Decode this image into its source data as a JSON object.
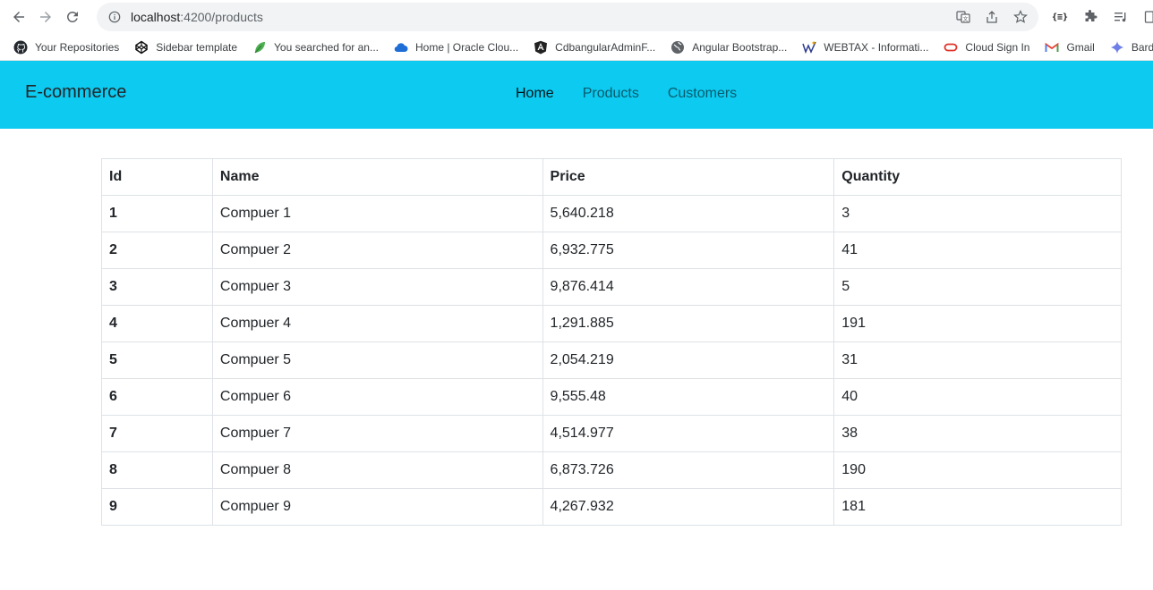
{
  "browser": {
    "url_host": "localhost",
    "url_rest": ":4200/products",
    "extension_label": "{≡}"
  },
  "bookmarks": [
    {
      "label": "Your Repositories",
      "icon": "github-icon"
    },
    {
      "label": "Sidebar template",
      "icon": "codepen-icon"
    },
    {
      "label": "You searched for an...",
      "icon": "leaf-icon"
    },
    {
      "label": "Home | Oracle Clou...",
      "icon": "cloud-icon"
    },
    {
      "label": "CdbangularAdminF...",
      "icon": "angular-icon"
    },
    {
      "label": "Angular Bootstrap...",
      "icon": "globe-icon"
    },
    {
      "label": "WEBTAX - Informati...",
      "icon": "webtax-icon"
    },
    {
      "label": "Cloud Sign In",
      "icon": "oracle-icon"
    },
    {
      "label": "Gmail",
      "icon": "gmail-icon"
    },
    {
      "label": "Bard",
      "icon": "bard-icon"
    }
  ],
  "navbar": {
    "brand": "E-commerce",
    "links": [
      {
        "label": "Home",
        "active": true
      },
      {
        "label": "Products",
        "active": false
      },
      {
        "label": "Customers",
        "active": false
      }
    ],
    "color": "#0dcaf0"
  },
  "table": {
    "headers": [
      "Id",
      "Name",
      "Price",
      "Quantity"
    ],
    "rows": [
      [
        "1",
        "Compuer 1",
        "5,640.218",
        "3"
      ],
      [
        "2",
        "Compuer 2",
        "6,932.775",
        "41"
      ],
      [
        "3",
        "Compuer 3",
        "9,876.414",
        "5"
      ],
      [
        "4",
        "Compuer 4",
        "1,291.885",
        "191"
      ],
      [
        "5",
        "Compuer 5",
        "2,054.219",
        "31"
      ],
      [
        "6",
        "Compuer 6",
        "9,555.48",
        "40"
      ],
      [
        "7",
        "Compuer 7",
        "4,514.977",
        "38"
      ],
      [
        "8",
        "Compuer 8",
        "6,873.726",
        "190"
      ],
      [
        "9",
        "Compuer 9",
        "4,267.932",
        "181"
      ]
    ]
  }
}
